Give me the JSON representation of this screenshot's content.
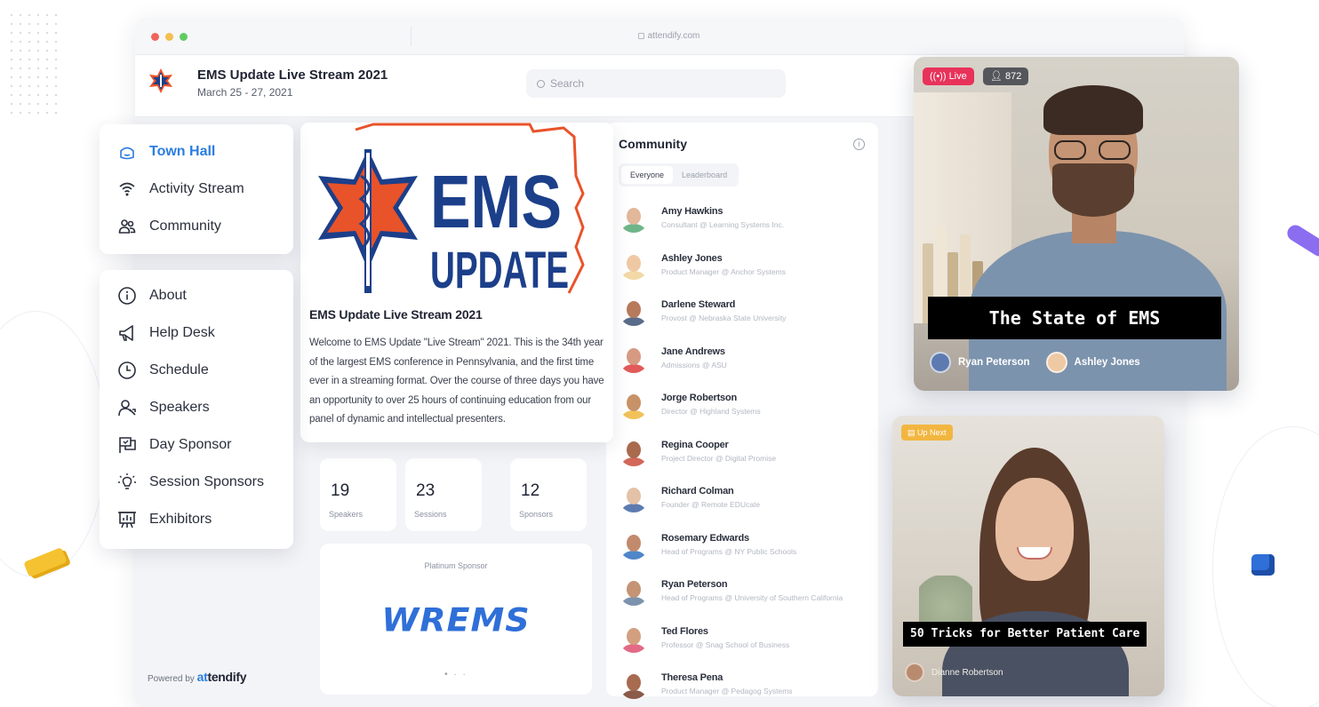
{
  "browser": {
    "url": "attendify.com"
  },
  "header": {
    "event_title": "EMS Update Live Stream 2021",
    "event_dates": "March 25 - 27, 2021",
    "search_placeholder": "Search"
  },
  "nav": {
    "primary": [
      {
        "label": "Town Hall",
        "icon": "home-icon",
        "active": true
      },
      {
        "label": "Activity Stream",
        "icon": "wifi-icon"
      },
      {
        "label": "Community",
        "icon": "people-icon"
      }
    ],
    "secondary": [
      {
        "label": "About",
        "icon": "info-icon"
      },
      {
        "label": "Help Desk",
        "icon": "megaphone-icon"
      },
      {
        "label": "Schedule",
        "icon": "clock-icon"
      },
      {
        "label": "Speakers",
        "icon": "speaker-person-icon"
      },
      {
        "label": "Day Sponsor",
        "icon": "flag-icon"
      },
      {
        "label": "Session Sponsors",
        "icon": "lightbulb-icon"
      },
      {
        "label": "Exhibitors",
        "icon": "booth-icon"
      }
    ]
  },
  "powered_by": {
    "prefix": "Powered by",
    "brand_a": "at",
    "brand_b": "tendify"
  },
  "main": {
    "banner": {
      "logo_word1": "EMS",
      "logo_word2": "UPDATE"
    },
    "title": "EMS Update Live Stream 2021",
    "description": "Welcome to EMS Update \"Live Stream\" 2021. This is the 34th year of the largest EMS conference in Pennsylvania, and the first time ever in a streaming format. Over the course of three days you have an opportunity to over 25 hours of continuing education from our panel of dynamic and intellectual presenters.",
    "stats": [
      {
        "value": "19",
        "label": "Speakers"
      },
      {
        "value": "23",
        "label": "Sessions"
      },
      {
        "value": "12",
        "label": "Sponsors"
      }
    ],
    "sponsor": {
      "label": "Platinum Sponsor",
      "logo_text": "WREMS",
      "pager": "• · ·"
    }
  },
  "community": {
    "title": "Community",
    "tabs": [
      "Everyone",
      "Leaderboard"
    ],
    "people": [
      {
        "name": "Amy Hawkins",
        "role": "Consultant @ Learning Systems Inc.",
        "skin": "#e2b79a",
        "shirt": "#6fb58a"
      },
      {
        "name": "Ashley Jones",
        "role": "Product Manager @ Anchor Systems",
        "skin": "#efc9a4",
        "shirt": "#f2d9a6"
      },
      {
        "name": "Darlene Steward",
        "role": "Provost @ Nebraska State University",
        "skin": "#b77a5a",
        "shirt": "#5a6c8a"
      },
      {
        "name": "Jane Andrews",
        "role": "Admissions @ ASU",
        "skin": "#d69a82",
        "shirt": "#e25a5a"
      },
      {
        "name": "Jorge Robertson",
        "role": "Director @ Highland Systems",
        "skin": "#c89268",
        "shirt": "#f2c25a"
      },
      {
        "name": "Regina Cooper",
        "role": "Project Director @ Digital Promise",
        "skin": "#a96a4e",
        "shirt": "#d2675a"
      },
      {
        "name": "Richard Colman",
        "role": "Founder @ Remote EDUcate",
        "skin": "#e3c2a8",
        "shirt": "#5d7bb0"
      },
      {
        "name": "Rosemary Edwards",
        "role": "Head of Programs @ NY Public Schools",
        "skin": "#c28a6c",
        "shirt": "#4f86c8"
      },
      {
        "name": "Ryan Peterson",
        "role": "Head of Programs @ University of Southern California",
        "skin": "#c49474",
        "shirt": "#7c93ad"
      },
      {
        "name": "Ted Flores",
        "role": "Professor @ Snag School of Business",
        "skin": "#d2a07e",
        "shirt": "#e26a86"
      },
      {
        "name": "Theresa Pena",
        "role": "Product Manager @ Pedagog Systems",
        "skin": "#a76b50",
        "shirt": "#8a5a4a"
      }
    ]
  },
  "live": {
    "badge": "Live",
    "viewers": "872",
    "session_title": "The State of EMS",
    "presenters": [
      {
        "name": "Ryan Peterson",
        "color": "#5d7bb0"
      },
      {
        "name": "Ashley Jones",
        "color": "#efc9a4"
      }
    ]
  },
  "up_next": {
    "badge": "Up Next",
    "session_title": "50 Tricks for Better Patient Care",
    "presenter": "Dianne Robertson"
  }
}
